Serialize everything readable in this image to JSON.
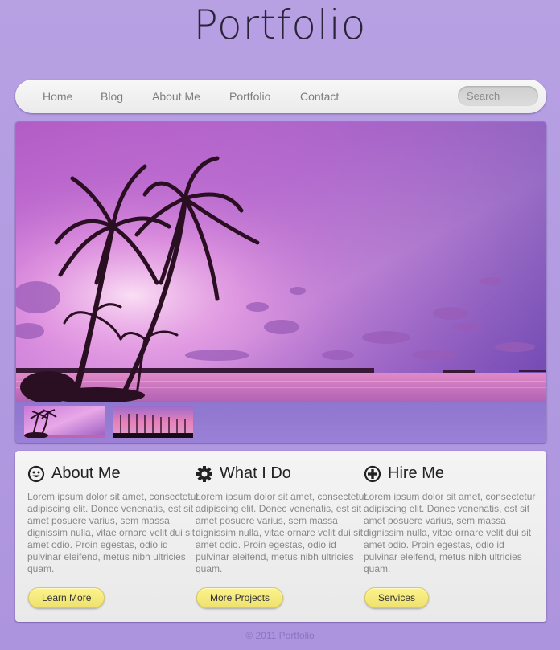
{
  "header": {
    "title": "Portfolio"
  },
  "nav": {
    "items": [
      {
        "label": "Home"
      },
      {
        "label": "Blog"
      },
      {
        "label": "About Me"
      },
      {
        "label": "Portfolio"
      },
      {
        "label": "Contact"
      }
    ],
    "search_placeholder": "Search",
    "search_value": ""
  },
  "slider": {
    "hero_alt": "Palm trees silhouetted against a purple-pink sunset over the ocean",
    "thumbnails": [
      {
        "alt": "Palm trees at sunset"
      },
      {
        "alt": "Row of trees at pink sunset"
      }
    ]
  },
  "columns": [
    {
      "icon": "smiley-icon",
      "title": "About Me",
      "body": "Lorem ipsum dolor sit amet, consectetur adipiscing elit. Donec venenatis, est sit amet posuere varius, sem massa dignissim nulla, vitae ornare velit dui sit amet odio. Proin egestas, odio id pulvinar eleifend, metus nibh ultricies quam.",
      "button": "Learn More"
    },
    {
      "icon": "gear-icon",
      "title": "What I Do",
      "body": "Lorem ipsum dolor sit amet, consectetur adipiscing elit. Donec venenatis, est sit amet posuere varius, sem massa dignissim nulla, vitae ornare velit dui sit amet odio. Proin egestas, odio id pulvinar eleifend, metus nibh ultricies quam.",
      "button": "More Projects"
    },
    {
      "icon": "plus-circle-icon",
      "title": "Hire Me",
      "body": "Lorem ipsum dolor sit amet, consectetur adipiscing elit. Donec venenatis, est sit amet posuere varius, sem massa dignissim nulla, vitae ornare velit dui sit amet odio. Proin egestas, odio id pulvinar eleifend, metus nibh ultricies quam.",
      "button": "Services"
    }
  ],
  "footer": {
    "text": "© 2011 Portfolio"
  },
  "colors": {
    "background": "#b099e0",
    "accent_button": "#f5e97c",
    "slider_frame": "#9077cf"
  }
}
